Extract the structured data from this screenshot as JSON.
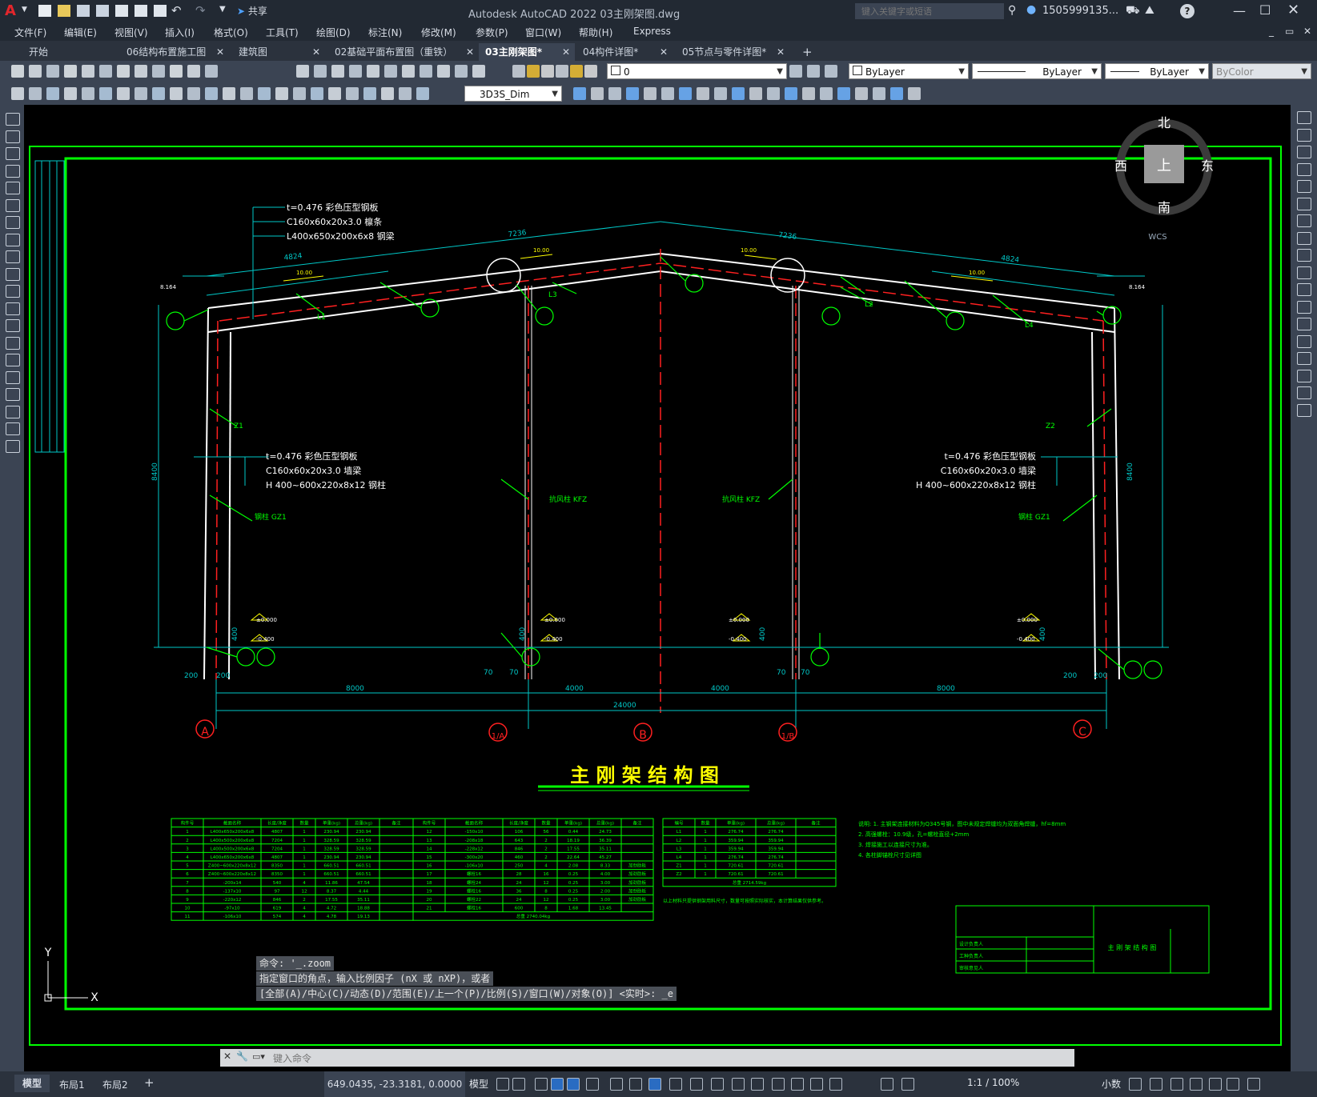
{
  "app": {
    "title": "Autodesk AutoCAD 2022    03主刚架图.dwg",
    "logo_letter": "A",
    "share_label": "共享",
    "search_placeholder": "键入关键字或短语",
    "user": "1505999135...",
    "help": "?"
  },
  "menu": [
    "文件(F)",
    "编辑(E)",
    "视图(V)",
    "插入(I)",
    "格式(O)",
    "工具(T)",
    "绘图(D)",
    "标注(N)",
    "修改(M)",
    "参数(P)",
    "窗口(W)",
    "帮助(H)",
    "Express"
  ],
  "tabs": [
    {
      "label": "开始",
      "closable": false
    },
    {
      "label": "06结构布置施工图",
      "closable": true
    },
    {
      "label": "建筑图",
      "closable": true
    },
    {
      "label": "02基础平面布置图（重铁）",
      "closable": true
    },
    {
      "label": "03主刚架图*",
      "closable": true,
      "active": true
    },
    {
      "label": "04构件详图*",
      "closable": true
    },
    {
      "label": "05节点与零件详图*",
      "closable": true
    }
  ],
  "properties": {
    "layer": "0",
    "color": "ByLayer",
    "linetype": "ByLayer",
    "lineweight": "ByLayer",
    "plotstyle": "ByColor",
    "dimstyle": "3D3S_Dim"
  },
  "viewcube": {
    "north": "北",
    "south": "南",
    "west": "西",
    "east": "东",
    "top": "上",
    "wcs": "WCS"
  },
  "command": {
    "history": [
      "命令: '_.zoom",
      "指定窗口的角点，输入比例因子 (nX 或 nXP)，或者",
      "[全部(A)/中心(C)/动态(D)/范围(E)/上一个(P)/比例(S)/窗口(W)/对象(O)] <实时>: _e"
    ],
    "placeholder": "键入命令"
  },
  "status": {
    "layout_tabs": [
      "模型",
      "布局1",
      "布局2"
    ],
    "coords": "649.0435, -23.3181, 0.0000",
    "model": "模型",
    "scale": "1:1 / 100%",
    "units": "小数"
  },
  "drawing": {
    "title": "主 刚 架 结 构 图",
    "dims": {
      "top_left": "7236",
      "top_right": "7236",
      "sub_left": "4824",
      "sub_right": "4824",
      "height_left": "8400",
      "height_right": "8400",
      "bay1": "8000",
      "bay2": "4000",
      "bay3": "4000",
      "bay4": "8000",
      "total": "24000",
      "d200": "200",
      "d70": "70",
      "d400": "400",
      "elev_top": "8.164",
      "elev_00": "±0.000",
      "elev_m04": "-0.400",
      "slope": "10.00"
    },
    "axes": [
      "A",
      "1/A",
      "B",
      "1/B",
      "C"
    ],
    "roof_callout": [
      "t=0.476 彩色压型钢板",
      "C160x60x20x3.0 檩条",
      "L400x650x200x6x8 钢梁"
    ],
    "wall_callout": [
      "t=0.476 彩色压型钢板",
      "C160x60x20x3.0 墙梁",
      "H 400~600x220x8x12 钢柱"
    ],
    "member_labels": [
      "L1",
      "L2",
      "L3",
      "L4",
      "Z1",
      "Z2",
      "钢柱 GZ1",
      "抗风柱 KFZ"
    ],
    "notes": [
      "说明: 1. 主钢架连接材料为Q345号钢，图中未规定焊缝均为双面角焊缝，hf=8mm",
      "2. 高强螺栓：10.9级，孔=螺栓直径+2mm",
      "3. 焊接施工以连接尺寸为准。",
      "4. 各柱脚锚栓尺寸见详图"
    ],
    "table_note": "以上材料只提供钢架用料尺寸，数量可按照实际核实，本计算结果仅供参考。",
    "title_block": {
      "name": "主 刚 架 结 构 图",
      "rows": [
        "设计负责人",
        "工种负责人",
        "审核意见人"
      ]
    },
    "table1": {
      "headers": [
        "构件号",
        "截面名称",
        "长度/净度",
        "数量",
        "单重(kg)",
        "总重(kg)",
        "备注"
      ],
      "rows": [
        [
          "1",
          "L400x650x200x6x8",
          "4807",
          "1",
          "230.94",
          "230.94",
          ""
        ],
        [
          "2",
          "L400x500x200x6x8",
          "7204",
          "1",
          "328.59",
          "328.59",
          ""
        ],
        [
          "3",
          "L400x500x200x6x8",
          "7204",
          "1",
          "328.59",
          "328.59",
          ""
        ],
        [
          "4",
          "L400x650x200x6x8",
          "4807",
          "1",
          "230.94",
          "230.94",
          ""
        ],
        [
          "5",
          "Z400~600x220x8x12",
          "8350",
          "1",
          "660.51",
          "660.51",
          ""
        ],
        [
          "6",
          "Z400~600x220x8x12",
          "8350",
          "1",
          "660.51",
          "660.51",
          ""
        ],
        [
          "7",
          "-200x14",
          "540",
          "4",
          "11.86",
          "47.54",
          ""
        ],
        [
          "8",
          "-137x10",
          "97",
          "12",
          "8.37",
          "4.44",
          ""
        ],
        [
          "9",
          "-220x12",
          "846",
          "2",
          "17.55",
          "35.11",
          ""
        ],
        [
          "10",
          "-97x10",
          "619",
          "4",
          "4.72",
          "18.88",
          ""
        ],
        [
          "11",
          "-106x10",
          "574",
          "4",
          "4.78",
          "19.13",
          ""
        ]
      ]
    },
    "table2": {
      "headers": [
        "构件号",
        "截面名称",
        "长度/净度",
        "数量",
        "单重(kg)",
        "总重(kg)",
        "备注"
      ],
      "rows": [
        [
          "12",
          "-150x10",
          "106",
          "56",
          "0.44",
          "24.73",
          ""
        ],
        [
          "13",
          "-208x18",
          "643",
          "2",
          "18.19",
          "36.39",
          ""
        ],
        [
          "14",
          "-228x12",
          "846",
          "2",
          "17.55",
          "35.11",
          ""
        ],
        [
          "15",
          "-300x20",
          "460",
          "2",
          "22.64",
          "45.27",
          ""
        ],
        [
          "16",
          "-106x10",
          "250",
          "4",
          "2.08",
          "8.33",
          "加劲肋板"
        ],
        [
          "17",
          "螺栓16",
          "28",
          "16",
          "0.25",
          "4.00",
          "加劲肋板"
        ],
        [
          "18",
          "螺栓24",
          "24",
          "12",
          "0.25",
          "3.00",
          "加劲肋板"
        ],
        [
          "19",
          "螺栓16",
          "36",
          "8",
          "0.25",
          "2.00",
          "加劲肋板"
        ],
        [
          "20",
          "螺栓22",
          "24",
          "12",
          "0.25",
          "3.00",
          "加劲肋板"
        ],
        [
          "21",
          "螺栓16",
          "600",
          "8",
          "1.68",
          "13.45",
          ""
        ]
      ],
      "total": "总重 2740.04kg"
    },
    "table3": {
      "headers": [
        "编号",
        "数量",
        "单重(kg)",
        "总重(kg)",
        "备注"
      ],
      "rows": [
        [
          "L1",
          "1",
          "276.74",
          "276.74",
          ""
        ],
        [
          "L2",
          "1",
          "359.94",
          "359.94",
          ""
        ],
        [
          "L3",
          "1",
          "359.94",
          "359.94",
          ""
        ],
        [
          "L4",
          "1",
          "276.74",
          "276.74",
          ""
        ],
        [
          "Z1",
          "1",
          "720.61",
          "720.61",
          ""
        ],
        [
          "Z2",
          "1",
          "720.61",
          "720.61",
          ""
        ]
      ],
      "total": "总重 2714.59kg"
    },
    "ucs": {
      "y": "Y",
      "x": "X"
    }
  },
  "colors": {
    "green": "#00ff00",
    "white": "#ffffff",
    "cyan": "#00c8c8",
    "red": "#ff2020",
    "yellow": "#ffff00"
  }
}
